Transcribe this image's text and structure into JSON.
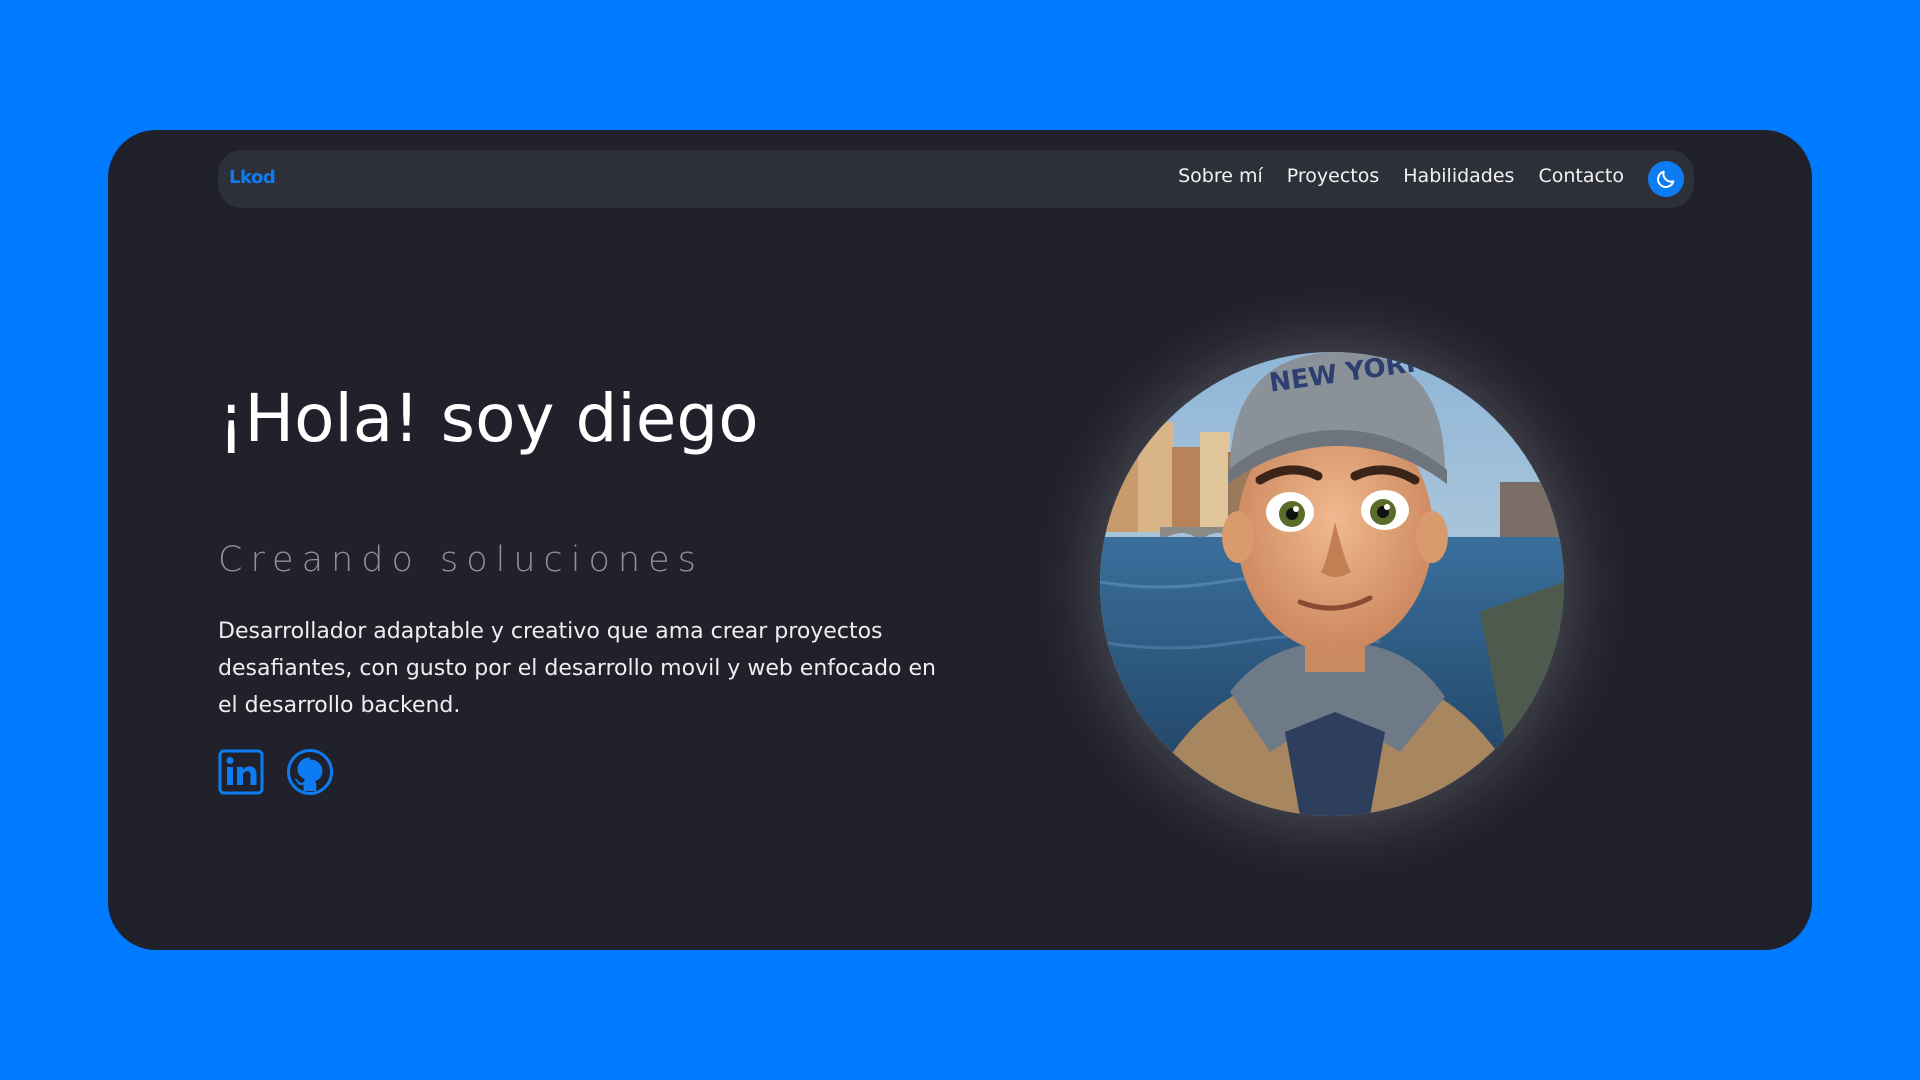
{
  "brand": {
    "name": "Lkod"
  },
  "nav": {
    "items": [
      {
        "label": "Sobre mí"
      },
      {
        "label": "Proyectos"
      },
      {
        "label": "Habilidades"
      },
      {
        "label": "Contacto"
      }
    ],
    "theme_toggle_icon": "moon-icon"
  },
  "hero": {
    "title": "¡Hola! soy diego",
    "subtitle": "Creando soluciones",
    "description": "Desarrollador adaptable y creativo que ama crear proyectos desafiantes, con gusto por el desarrollo movil y web enfocado en el desarrollo backend.",
    "socials": [
      {
        "icon": "linkedin-icon"
      },
      {
        "icon": "github-icon"
      }
    ],
    "avatar": {
      "image": "cartoon-avatar"
    }
  },
  "colors": {
    "page_background": "#007bff",
    "card_background": "#20212b",
    "navbar_background": "#2e3039",
    "accent": "#0d7cf2",
    "subtitle": "#8d8f99",
    "text": "#ffffff"
  }
}
